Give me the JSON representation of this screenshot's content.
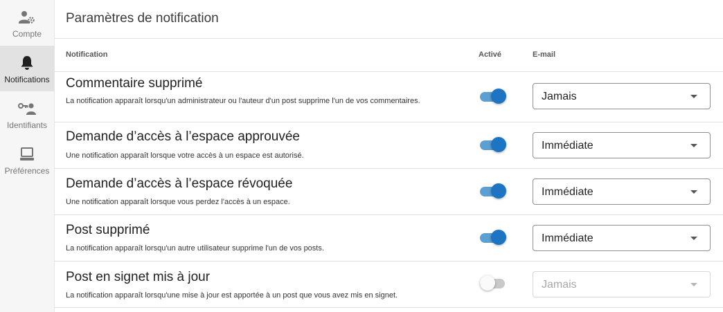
{
  "sidebar": {
    "items": [
      {
        "label": "Compte",
        "icon": "account-settings-icon"
      },
      {
        "label": "Notifications",
        "icon": "bell-icon"
      },
      {
        "label": "Identifiants",
        "icon": "key-user-icon"
      },
      {
        "label": "Préférences",
        "icon": "monitor-icon"
      }
    ],
    "active": "Notifications"
  },
  "page": {
    "title": "Paramètres de notification"
  },
  "columns": {
    "notification": "Notification",
    "active": "Activé",
    "email": "E-mail"
  },
  "notifications": [
    {
      "title": "Commentaire supprimé",
      "description": "La notification apparaît lorsqu'un administrateur ou l'auteur d'un post supprime l'un de vos commentaires.",
      "enabled": true,
      "email": "Jamais"
    },
    {
      "title": "Demande d’accès à l’espace approuvée",
      "description": "Une notification apparaît lorsque votre accès à un espace est autorisé.",
      "enabled": true,
      "email": "Immédiate"
    },
    {
      "title": "Demande d’accès à l’espace révoquée",
      "description": "Une notification apparaît lorsque vous perdez l'accès à un espace.",
      "enabled": true,
      "email": "Immédiate"
    },
    {
      "title": "Post supprimé",
      "description": "La notification apparaît lorsqu'un autre utilisateur supprime l'un de vos posts.",
      "enabled": true,
      "email": "Immédiate"
    },
    {
      "title": "Post en signet mis à jour",
      "description": "La notification apparaît lorsqu'une mise à jour est apportée à un post que vous avez mis en signet.",
      "enabled": false,
      "email": "Jamais"
    }
  ],
  "colors": {
    "accent": "#1d74c3",
    "accent_track": "#5c9fd3",
    "sidebar_bg": "#f6f6f6",
    "active_bg": "#e2e2e2"
  }
}
